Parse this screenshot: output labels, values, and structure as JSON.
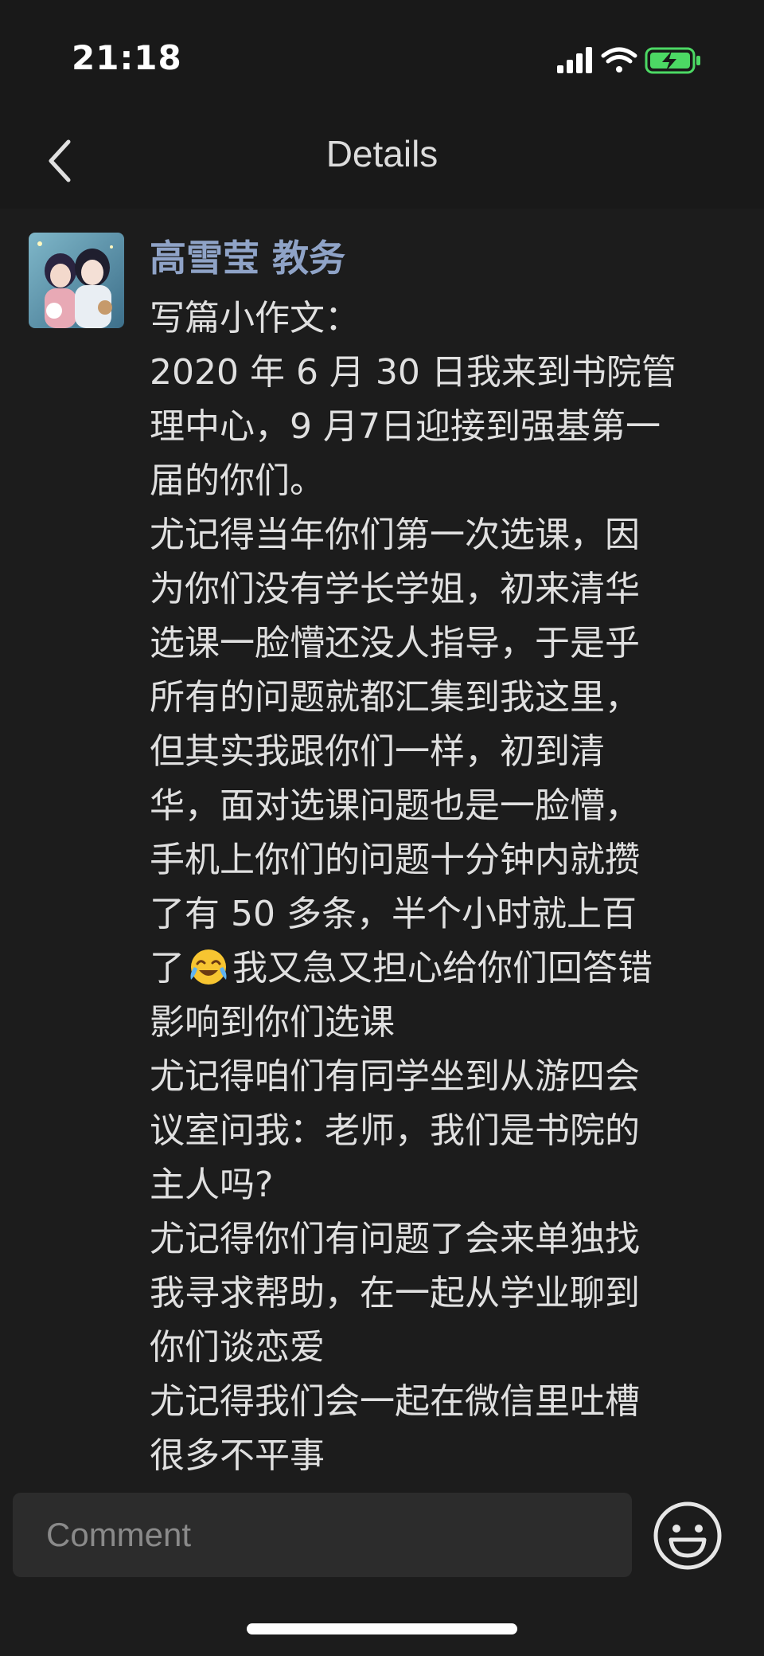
{
  "status_bar": {
    "time": "21:18"
  },
  "nav": {
    "title": "Details"
  },
  "post": {
    "author": "高雪莹 教务",
    "lines": [
      "写篇小作文：",
      "2020 年 6 月 30 日我来到书院管",
      "理中心，9 月7日迎接到强基第一",
      "届的你们。",
      "尤记得当年你们第一次选课，因",
      "为你们没有学长学姐，初来清华",
      "选课一脸懵还没人指导，于是乎",
      "所有的问题就都汇集到我这里，",
      "但其实我跟你们一样，初到清",
      "华，面对选课问题也是一脸懵，",
      "手机上你们的问题十分钟内就攒",
      "了有 50 多条，半个小时就上百"
    ],
    "emoji_line_before": "了",
    "emoji_line_after": "我又急又担心给你们回答错",
    "lines_after": [
      "影响到你们选课",
      "尤记得咱们有同学坐到从游四会",
      "议室问我：老师，我们是书院的",
      "主人吗?",
      "尤记得你们有问题了会来单独找",
      "我寻求帮助，在一起从学业聊到",
      "你们谈恋爱",
      "尤记得我们会一起在微信里吐槽",
      "很多不平事"
    ]
  },
  "comment": {
    "placeholder": "Comment"
  },
  "icons": {
    "back": "chevron-left-icon",
    "emoji": "smiley-face-icon",
    "inline_emoji": "crying-laughing-emoji"
  },
  "colors": {
    "background": "#191919",
    "author_name": "#8fa3c7",
    "battery": "#4cd964"
  }
}
